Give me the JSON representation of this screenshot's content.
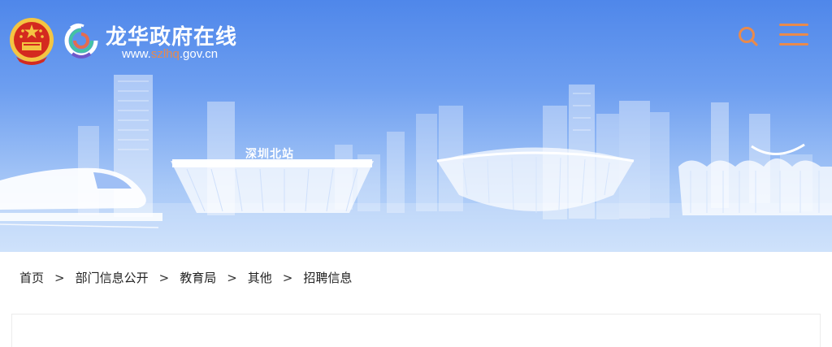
{
  "header": {
    "title": "龙华政府在线",
    "url_prefix": "www.",
    "url_highlight": "szlhq",
    "url_suffix": ".gov.cn",
    "emblem_icon": "national-emblem-icon",
    "logo_icon": "longhua-logo-icon",
    "search_icon": "search-icon",
    "menu_icon": "hamburger-menu-icon"
  },
  "banner": {
    "station_label": "深圳北站"
  },
  "breadcrumb": {
    "items": [
      "首页",
      "部门信息公开",
      "教育局",
      "其他",
      "招聘信息"
    ],
    "separator": ">"
  },
  "colors": {
    "banner_top": "#4f87ea",
    "banner_bottom": "#c3dbfa",
    "accent_orange": "#e98a4c",
    "emblem_red": "#d42a1f",
    "emblem_gold": "#f4c542"
  }
}
